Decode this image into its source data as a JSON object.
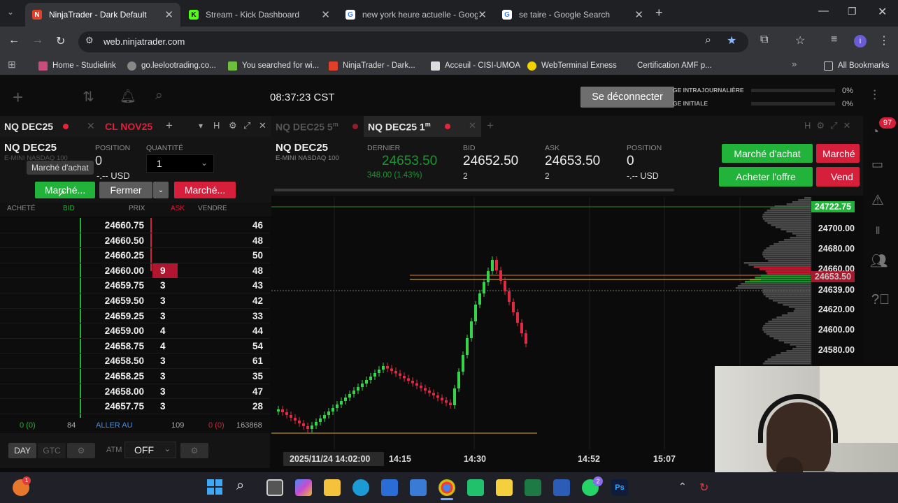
{
  "browser": {
    "tabs": [
      {
        "title": "NinjaTrader - Dark Default",
        "fav": "N",
        "color": "#e0402a"
      },
      {
        "title": "Stream - Kick Dashboard",
        "fav": "K",
        "color": "#53fc18"
      },
      {
        "title": "new york heure actuelle - Goog",
        "fav": "G",
        "color": "#ffffff"
      },
      {
        "title": "se taire - Google Search",
        "fav": "G",
        "color": "#ffffff"
      }
    ],
    "url": "web.ninjatrader.com",
    "bookmarks": [
      "Home - Studielink",
      "go.leelootrading.co...",
      "You searched for wi...",
      "NinjaTrader - Dark...",
      "Acceuil - CISI-UMOA",
      "WebTerminal Exness",
      "Certification AMF p...",
      "All Bookmarks"
    ],
    "profile_initial": "i"
  },
  "app": {
    "clock": "08:37:23 CST",
    "logout": "Se déconnecter",
    "risk": [
      {
        "label": "GE INTRAJOURNALIÈRE",
        "value": "0%"
      },
      {
        "label": "GE INITIALE",
        "value": "0%"
      }
    ],
    "notif_count": "97",
    "tabs_left": {
      "active": "NQ DEC25",
      "second": "CL NOV25"
    },
    "tabs_right": {
      "first": "NQ DEC25 5",
      "first_sup": "m",
      "active": "NQ DEC25 1",
      "active_sup": "m"
    }
  },
  "dom": {
    "symbol": "NQ DEC25",
    "desc": "E-MINI NASDAQ 100",
    "position_label": "POSITION",
    "position_value": "0",
    "qty_label": "QUANTITÉ",
    "qty_value": "1",
    "tooltip": "Marché d'achat",
    "currency": "-.-- USD",
    "btn_buy": "Marché...",
    "btn_close": "Fermer",
    "btn_sell": "Marché...",
    "headers": [
      "ACHETÉ",
      "BID",
      "PRIX",
      "ASK",
      "VENDRE"
    ],
    "rows": [
      {
        "price": "24660.75",
        "ask": "",
        "vend": "46"
      },
      {
        "price": "24660.50",
        "ask": "",
        "vend": "48"
      },
      {
        "price": "24660.25",
        "ask": "",
        "vend": "50"
      },
      {
        "price": "24660.00",
        "ask": "9",
        "vend": "48"
      },
      {
        "price": "24659.75",
        "ask": "3",
        "vend": "43"
      },
      {
        "price": "24659.50",
        "ask": "3",
        "vend": "42"
      },
      {
        "price": "24659.25",
        "ask": "3",
        "vend": "33"
      },
      {
        "price": "24659.00",
        "ask": "4",
        "vend": "44"
      },
      {
        "price": "24658.75",
        "ask": "4",
        "vend": "54"
      },
      {
        "price": "24658.50",
        "ask": "3",
        "vend": "61"
      },
      {
        "price": "24658.25",
        "ask": "3",
        "vend": "35"
      },
      {
        "price": "24658.00",
        "ask": "3",
        "vend": "47"
      },
      {
        "price": "24657.75",
        "ask": "3",
        "vend": "28"
      }
    ],
    "footer": {
      "left": "0 (0)",
      "bid_total": "84",
      "goto": "ALLER AU",
      "ask_total": "109",
      "right": "0 (0)",
      "vol": "163868"
    },
    "day": "DAY",
    "gtc": "GTC",
    "atm_label": "ATM",
    "atm_value": "OFF"
  },
  "chart_header": {
    "symbol": "NQ DEC25",
    "desc": "E-MINI NASDAQ 100",
    "last_label": "DERNIER",
    "last": "24653.50",
    "change": "348.00 (1.43%)",
    "bid_label": "BID",
    "bid": "24652.50",
    "bid_size": "2",
    "ask_label": "ASK",
    "ask": "24653.50",
    "ask_size": "2",
    "pos_label": "POSITION",
    "pos": "0",
    "usd": "-.-- USD",
    "buy_market": "Marché d'achat",
    "sell_market": "Marché",
    "buy_offer": "Acheter l'offre",
    "sell": "Vend"
  },
  "chart_data": {
    "type": "candlestick",
    "y_ticks": [
      "24700.00",
      "24680.00",
      "24660.00",
      "24639.00",
      "24620.00",
      "24600.00",
      "24580.00"
    ],
    "price_tags": [
      {
        "label": "24722.75",
        "color": "#22b33a"
      },
      {
        "label": "24653.50",
        "color": "#d61f3b"
      }
    ],
    "x_labels": [
      "2025/11/24 14:02:00",
      "14:15",
      "14:30",
      "14:52",
      "15:07"
    ]
  },
  "taskbar": {
    "badge": "2"
  }
}
